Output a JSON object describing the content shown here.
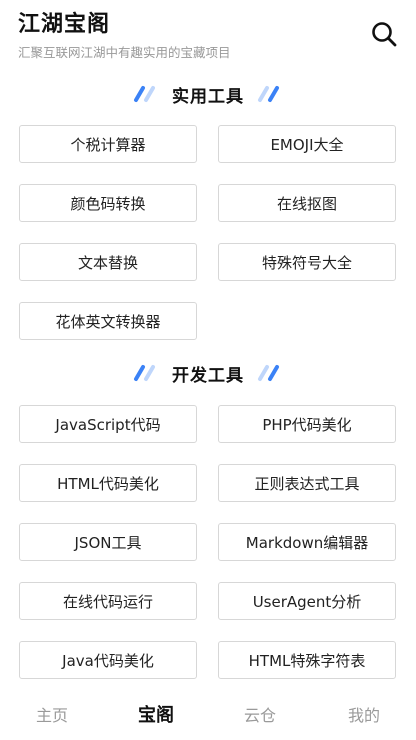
{
  "header": {
    "title": "江湖宝阁",
    "subtitle": "汇聚互联网江湖中有趣实用的宝藏项目",
    "search_icon": "search-icon"
  },
  "sections": [
    {
      "title": "实用工具",
      "items": [
        "个税计算器",
        "EMOJI大全",
        "颜色码转换",
        "在线抠图",
        "文本替换",
        "特殊符号大全",
        "花体英文转换器"
      ]
    },
    {
      "title": "开发工具",
      "items": [
        "JavaScript代码",
        "PHP代码美化",
        "HTML代码美化",
        "正则表达式工具",
        "JSON工具",
        "Markdown编辑器",
        "在线代码运行",
        "UserAgent分析",
        "Java代码美化",
        "HTML特殊字符表"
      ]
    }
  ],
  "tabbar": {
    "tabs": [
      "主页",
      "宝阁",
      "云仓",
      "我的"
    ],
    "active": "宝阁"
  },
  "colors": {
    "accent_dark": "#3b82f6",
    "accent_light": "#bfd6fb"
  }
}
